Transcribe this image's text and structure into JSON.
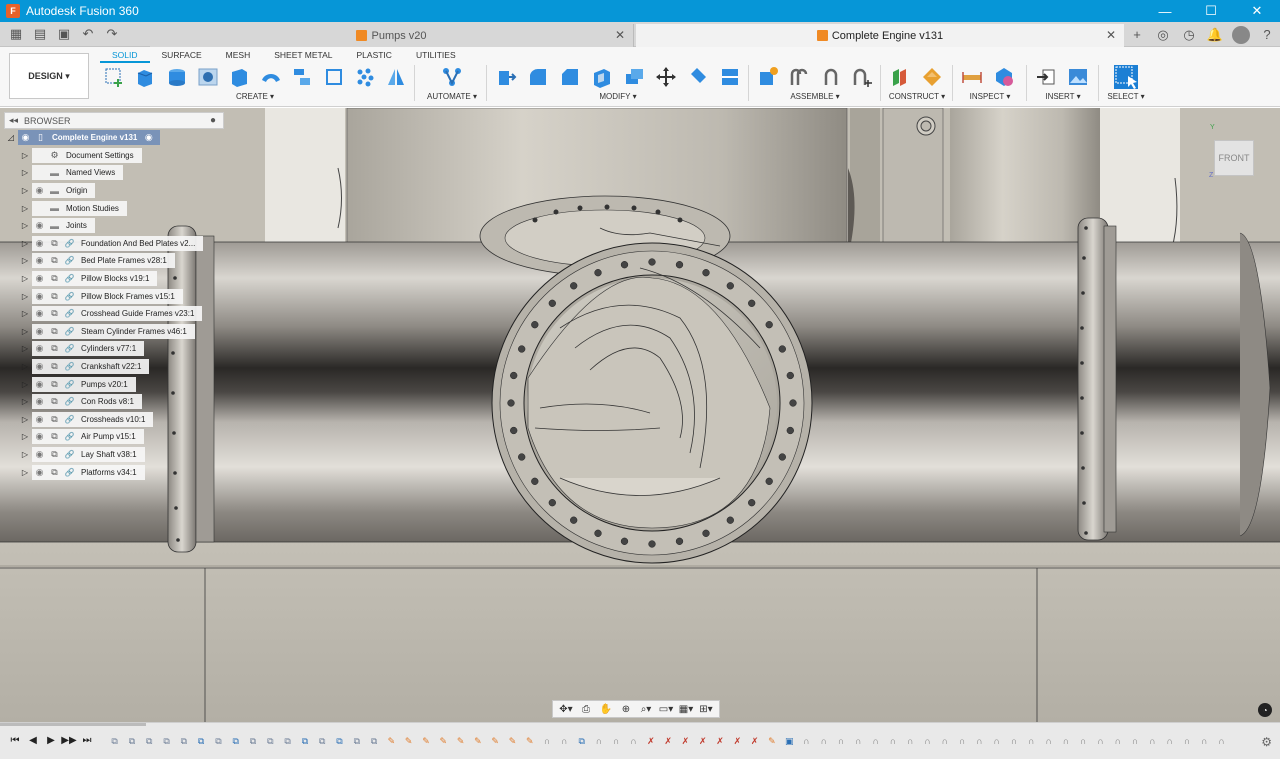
{
  "window": {
    "title": "Autodesk Fusion 360",
    "minimize": "—",
    "maximize": "☐",
    "close": "✕"
  },
  "tabs": [
    {
      "label": "Pumps v20",
      "close": "✕"
    },
    {
      "label": "Complete Engine v131",
      "close": "✕"
    }
  ],
  "toolbar": {
    "workspace": "DESIGN ▾",
    "subtabs": [
      "SOLID",
      "SURFACE",
      "MESH",
      "SHEET METAL",
      "PLASTIC",
      "UTILITIES"
    ],
    "groups": [
      "CREATE ▾",
      "AUTOMATE ▾",
      "MODIFY ▾",
      "ASSEMBLE ▾",
      "CONSTRUCT ▾",
      "INSPECT ▾",
      "INSERT ▾",
      "SELECT ▾"
    ]
  },
  "browser": {
    "title": "BROWSER",
    "root": "Complete Engine v131",
    "items": [
      {
        "label": "Document Settings",
        "kind": "gear"
      },
      {
        "label": "Named Views",
        "kind": "folder"
      },
      {
        "label": "Origin",
        "kind": "folder"
      },
      {
        "label": "Motion Studies",
        "kind": "folder"
      },
      {
        "label": "Joints",
        "kind": "folder"
      },
      {
        "label": "Foundation And Bed Plates v2...",
        "kind": "component"
      },
      {
        "label": "Bed Plate Frames v28:1",
        "kind": "component"
      },
      {
        "label": "Pillow Blocks v19:1",
        "kind": "component"
      },
      {
        "label": "Pillow Block Frames v15:1",
        "kind": "component"
      },
      {
        "label": "Crosshead Guide Frames v23:1",
        "kind": "component"
      },
      {
        "label": "Steam Cylinder Frames v46:1",
        "kind": "component"
      },
      {
        "label": "Cylinders v77:1",
        "kind": "component"
      },
      {
        "label": "Crankshaft v22:1",
        "kind": "component"
      },
      {
        "label": "Pumps v20:1",
        "kind": "component"
      },
      {
        "label": "Con Rods v8:1",
        "kind": "component"
      },
      {
        "label": "Crossheads v10:1",
        "kind": "component"
      },
      {
        "label": "Air Pump v15:1",
        "kind": "component"
      },
      {
        "label": "Lay Shaft v38:1",
        "kind": "component"
      },
      {
        "label": "Platforms v34:1",
        "kind": "component"
      }
    ]
  },
  "viewcube": {
    "face": "FRONT",
    "axis_y": "Y",
    "axis_z": "Z"
  },
  "colors": {
    "accent": "#0696d7",
    "title_bar": "#0696d7",
    "root_highlight": "#7a93b8"
  }
}
